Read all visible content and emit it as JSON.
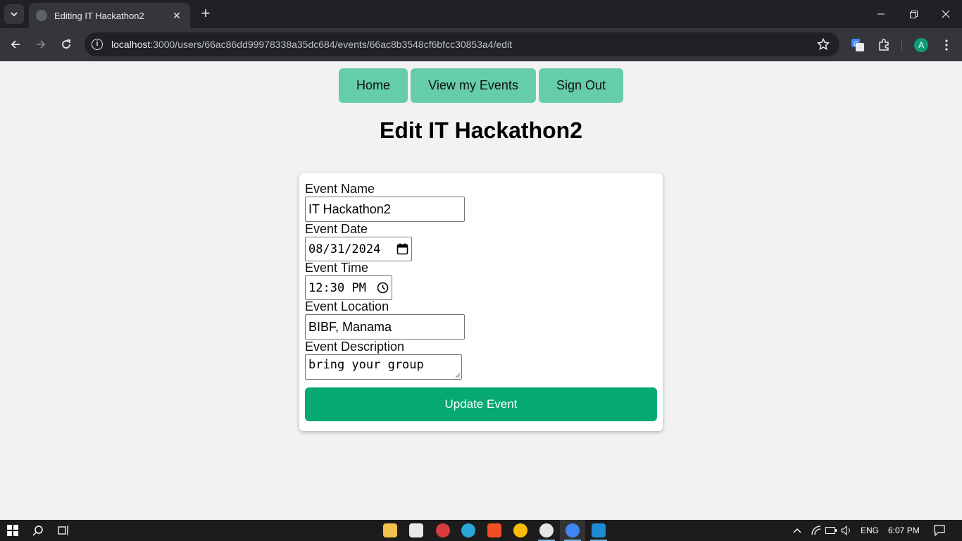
{
  "browser": {
    "tab_title": "Editing IT Hackathon2",
    "url_host": "localhost",
    "url_rest": ":3000/users/66ac86dd99978338a35dc684/events/66ac8b3548cf6bfcc30853a4/edit",
    "profile_initial": "A"
  },
  "nav": {
    "home": "Home",
    "view_events": "View my Events",
    "sign_out": "Sign Out"
  },
  "page": {
    "title": "Edit IT Hackathon2"
  },
  "form": {
    "name_label": "Event Name",
    "name_value": "IT Hackathon2",
    "date_label": "Event Date",
    "date_value": "08/31/2024",
    "time_label": "Event Time",
    "time_value": "12:30 PM",
    "location_label": "Event Location",
    "location_value": "BIBF, Manama",
    "description_label": "Event Description",
    "description_value": "bring your group",
    "submit_label": "Update Event"
  },
  "taskbar": {
    "language": "ENG",
    "clock": "6:07 PM"
  },
  "colors": {
    "nav_button": "#66cdaa",
    "submit_button": "#06a96f",
    "page_background": "#f2f2f2"
  }
}
